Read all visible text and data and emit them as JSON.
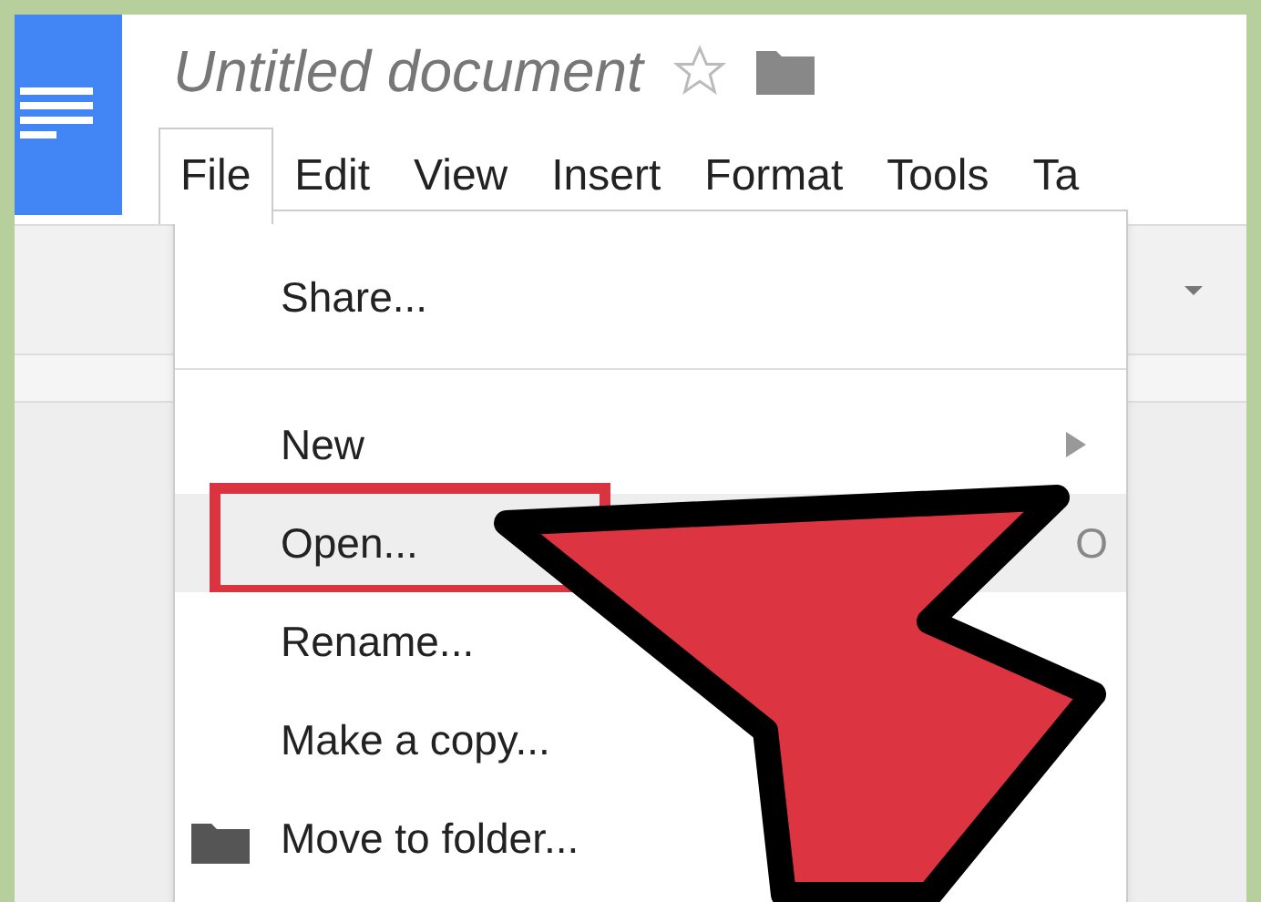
{
  "document": {
    "title": "Untitled document",
    "starred": false
  },
  "menu_bar": [
    {
      "label": "File",
      "selected": true
    },
    {
      "label": "Edit",
      "selected": false
    },
    {
      "label": "View",
      "selected": false
    },
    {
      "label": "Insert",
      "selected": false
    },
    {
      "label": "Format",
      "selected": false
    },
    {
      "label": "Tools",
      "selected": false
    },
    {
      "label": "Ta",
      "selected": false
    }
  ],
  "file_menu": {
    "groups": [
      [
        {
          "label": "Share...",
          "kind": "plain",
          "selected": false
        }
      ],
      [
        {
          "label": "New",
          "kind": "submenu",
          "selected": false
        },
        {
          "label": "Open...",
          "kind": "plain",
          "selected": true,
          "shortcut": "O"
        },
        {
          "label": "Rename...",
          "kind": "plain",
          "selected": false
        },
        {
          "label": "Make a copy...",
          "kind": "plain",
          "selected": false
        },
        {
          "label": "Move to folder...",
          "kind": "folder",
          "selected": false
        }
      ]
    ]
  }
}
